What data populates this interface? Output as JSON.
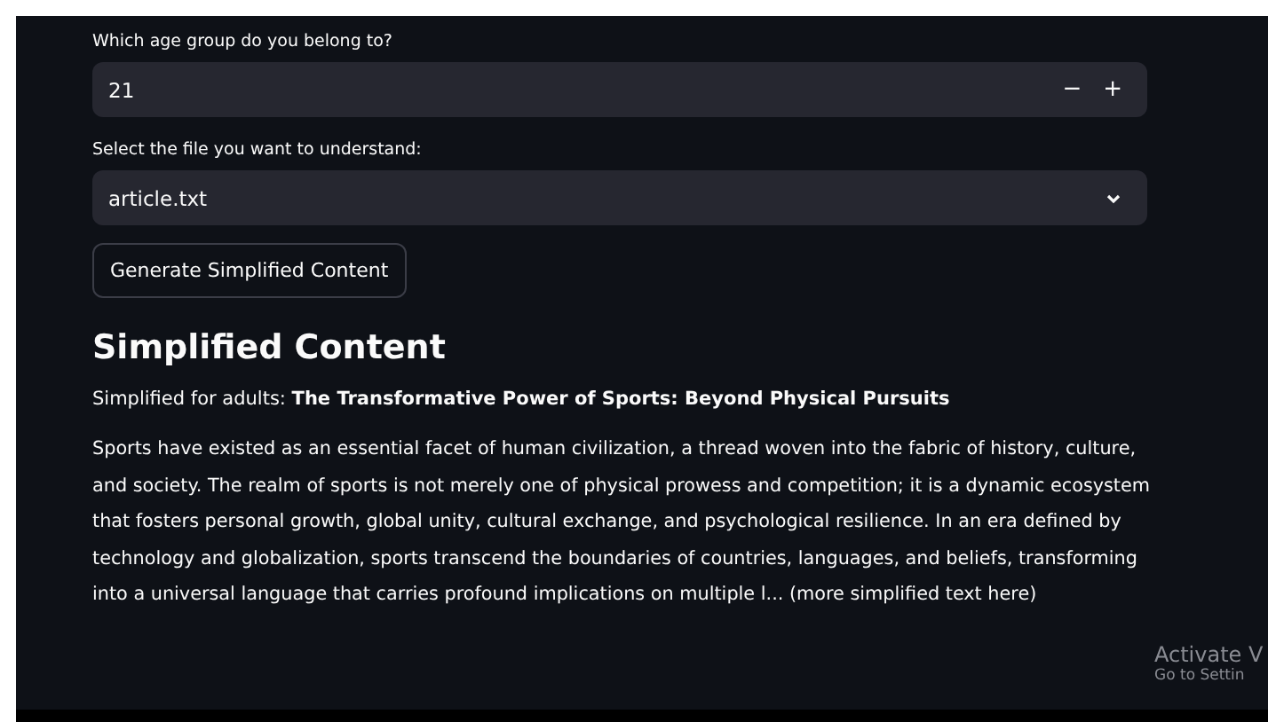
{
  "age_input": {
    "label": "Which age group do you belong to?",
    "value": "21",
    "decrement": "−",
    "increment": "+"
  },
  "file_select": {
    "label": "Select the file you want to understand:",
    "value": "article.txt"
  },
  "generate_button": {
    "label": "Generate Simplified Content"
  },
  "result": {
    "heading": "Simplified Content",
    "subtitle": "Simplified for adults: **The Transformative Power of Sports: Beyond Physical Pursuits**",
    "body": "Sports have existed as an essential facet of human civilization, a thread woven into the fabric of history, culture, and society. The realm of sports is not merely one of physical prowess and competition; it is a dynamic ecosystem that fosters personal growth, global unity, cultural exchange, and psychological resilience. In an era defined by technology and globalization, sports transcend the boundaries of countries, languages, and beliefs, transforming into a universal language that carries profound implications on multiple l... (more simplified text here)"
  },
  "activation_notice": {
    "title": "Activate V",
    "subtitle": "Go to Settin"
  }
}
